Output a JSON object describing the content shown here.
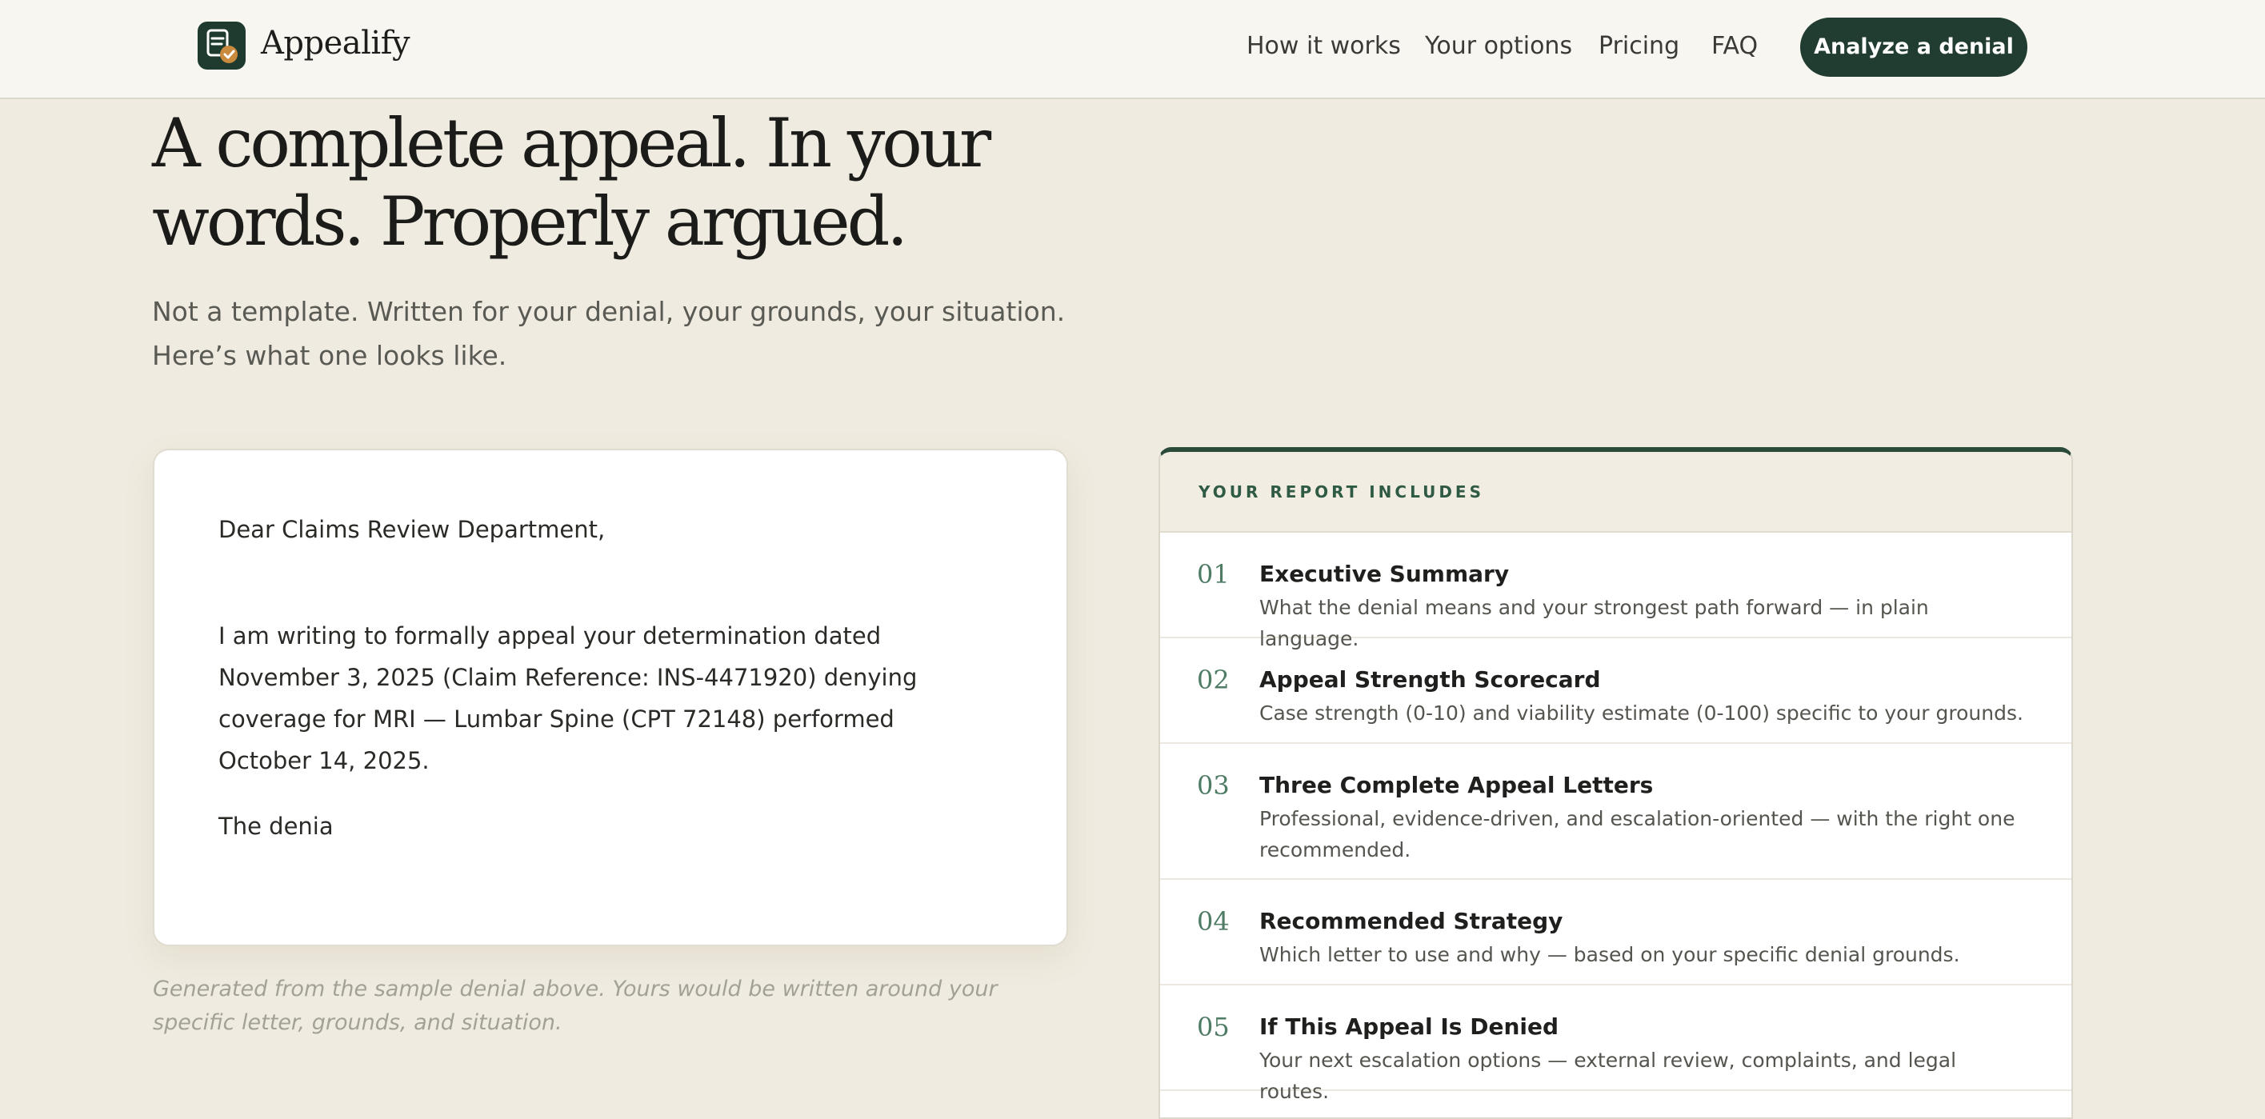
{
  "header": {
    "brand": "Appealify",
    "nav": {
      "how_it_works": "How it works",
      "your_options": "Your options",
      "pricing": "Pricing",
      "faq": "FAQ"
    },
    "cta_label": "Analyze a denial"
  },
  "hero": {
    "title_line1": "A complete appeal. In your",
    "title_line2": "words. Properly argued.",
    "subtitle_line1": "Not a template. Written for your denial, your grounds, your situation.",
    "subtitle_line2": "Here’s what one looks like."
  },
  "letter": {
    "greeting": "Dear Claims Review Department,",
    "paragraph": "I am writing to formally appeal your determination dated November 3, 2025 (Claim Reference: INS-4471920) denying coverage for MRI — Lumbar Spine (CPT 72148) performed October 14, 2025.",
    "truncated": "The denia",
    "caption": "Generated from the sample denial above. Yours would be written around your specific letter, grounds, and situation."
  },
  "report": {
    "label": "YOUR REPORT INCLUDES",
    "items": [
      {
        "num": "01",
        "title": "Executive Summary",
        "desc": "What the denial means and your strongest path forward — in plain language."
      },
      {
        "num": "02",
        "title": "Appeal Strength Scorecard",
        "desc": "Case strength (0-10) and viability estimate (0-100) specific to your grounds."
      },
      {
        "num": "03",
        "title": "Three Complete Appeal Letters",
        "desc": "Professional, evidence-driven, and escalation-oriented — with the right one recommended."
      },
      {
        "num": "04",
        "title": "Recommended Strategy",
        "desc": "Which letter to use and why — based on your specific denial grounds."
      },
      {
        "num": "05",
        "title": "If This Appeal Is Denied",
        "desc": "Your next escalation options — external review, complaints, and legal routes."
      }
    ]
  },
  "colors": {
    "accent": "#213c30",
    "background": "#f0ebe0",
    "number_green": "#4e7c64",
    "logo_check": "#c98a3e"
  },
  "icons": {
    "logo": "document-check-icon"
  }
}
